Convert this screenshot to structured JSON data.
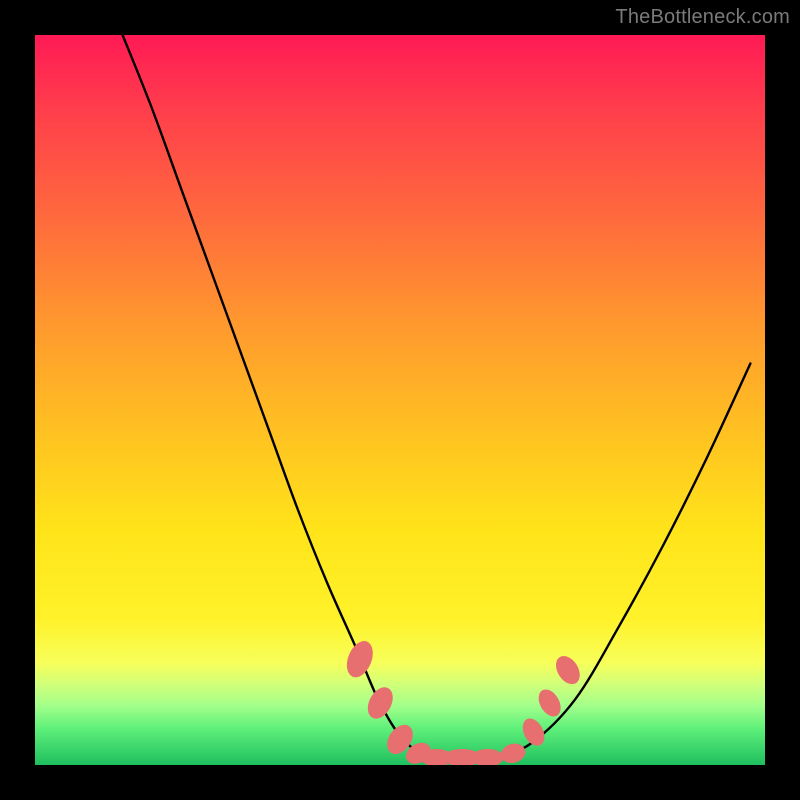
{
  "watermark": "TheBottleneck.com",
  "chart_data": {
    "type": "line",
    "title": "",
    "xlabel": "",
    "ylabel": "",
    "xlim": [
      0,
      100
    ],
    "ylim": [
      0,
      100
    ],
    "grid": false,
    "legend": false,
    "series": [
      {
        "name": "curve",
        "x": [
          12,
          16,
          20,
          24,
          28,
          32,
          36,
          40,
          44,
          47,
          50,
          53,
          56,
          59,
          63,
          68,
          74,
          80,
          86,
          92,
          98
        ],
        "y": [
          100,
          90,
          79,
          68,
          57,
          46,
          35,
          25,
          16,
          9,
          4,
          1.5,
          1,
          1,
          1,
          3,
          9,
          19,
          30,
          42,
          55
        ],
        "color": "#000000"
      }
    ],
    "markers": [
      {
        "x": 44.5,
        "y": 14.5,
        "rx": 1.6,
        "ry": 2.6,
        "angle": 22
      },
      {
        "x": 47.3,
        "y": 8.5,
        "rx": 1.5,
        "ry": 2.3,
        "angle": 28
      },
      {
        "x": 50.0,
        "y": 3.5,
        "rx": 1.5,
        "ry": 2.2,
        "angle": 35
      },
      {
        "x": 52.5,
        "y": 1.6,
        "rx": 1.3,
        "ry": 1.8,
        "angle": 60
      },
      {
        "x": 55.0,
        "y": 1.0,
        "rx": 2.2,
        "ry": 1.2,
        "angle": 0
      },
      {
        "x": 58.5,
        "y": 1.0,
        "rx": 2.6,
        "ry": 1.2,
        "angle": 0
      },
      {
        "x": 62.0,
        "y": 1.0,
        "rx": 2.2,
        "ry": 1.2,
        "angle": 0
      },
      {
        "x": 65.5,
        "y": 1.6,
        "rx": 1.7,
        "ry": 1.3,
        "angle": -15
      },
      {
        "x": 68.3,
        "y": 4.5,
        "rx": 1.3,
        "ry": 2.0,
        "angle": -28
      },
      {
        "x": 70.5,
        "y": 8.5,
        "rx": 1.3,
        "ry": 2.0,
        "angle": -30
      },
      {
        "x": 73.0,
        "y": 13.0,
        "rx": 1.4,
        "ry": 2.1,
        "angle": -32
      }
    ],
    "marker_color": "#e76f6f",
    "background": "rainbow-vertical"
  }
}
